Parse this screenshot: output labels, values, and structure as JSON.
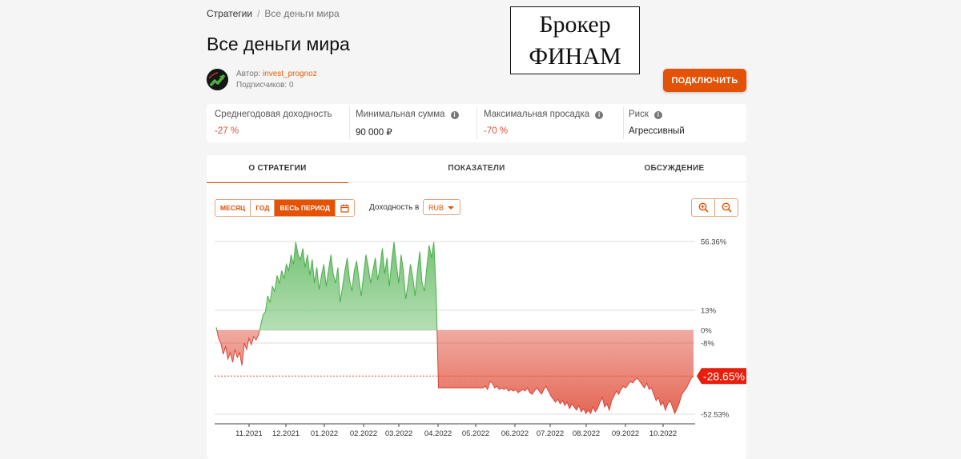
{
  "breadcrumb": {
    "parent": "Стратегии",
    "separator": "/",
    "current": "Все деньги мира"
  },
  "page_title": "Все деньги мира",
  "author": {
    "label": "Автор:",
    "name": "invest_prognoz",
    "subscribers": "Подписчиков: 0"
  },
  "watermark": {
    "line1": "Брокер",
    "line2": "ФИНАМ"
  },
  "connect_button": "ПОДКЛЮЧИТЬ",
  "stats": [
    {
      "label": "Среднегодовая доходность",
      "value": "-27 %",
      "info": false,
      "negative": true
    },
    {
      "label": "Минимальная сумма",
      "value": "90 000 ₽",
      "info": true,
      "negative": false
    },
    {
      "label": "Максимальная просадка",
      "value": "-70 %",
      "info": true,
      "negative": true
    },
    {
      "label": "Риск",
      "value": "Агрессивный",
      "info": true,
      "negative": false
    }
  ],
  "tabs": [
    {
      "label": "О СТРАТЕГИИ",
      "active": true
    },
    {
      "label": "ПОКАЗАТЕЛИ",
      "active": false
    },
    {
      "label": "ОБСУЖДЕНИЕ",
      "active": false
    }
  ],
  "period_buttons": [
    {
      "label": "МЕСЯЦ",
      "active": false
    },
    {
      "label": "ГОД",
      "active": false
    },
    {
      "label": "ВЕСЬ ПЕРИОД",
      "active": true
    }
  ],
  "yield_label": "Доходность в",
  "currency": "RUB",
  "icons": {
    "calendar": "calendar-icon",
    "zoom_in": "zoom-in-icon",
    "zoom_out": "zoom-out-icon",
    "info": "info-icon"
  },
  "colors": {
    "accent": "#e35205",
    "positive": "#5cb85c",
    "negative": "#e04e39"
  },
  "chart_data": {
    "type": "area",
    "y_ticks": [
      56.36,
      13,
      0,
      -8,
      -52.53
    ],
    "y_tick_labels": [
      "56.36%",
      "13%",
      "0%",
      "-8%",
      "-52.53%"
    ],
    "current_value_label": "-28.65%",
    "current_value": -28.65,
    "x_ticks": [
      "11.2021",
      "12.2021",
      "01.2022",
      "02.2022",
      "03.2022",
      "04.2022",
      "05.2022",
      "06.2022",
      "07.2022",
      "08.2022",
      "09.2022",
      "10.2022"
    ],
    "series": [
      {
        "values": [
          2,
          -5,
          -8,
          -15,
          -10,
          -18,
          -14,
          -20,
          -12,
          -17,
          -14,
          -22,
          -8,
          -12,
          -5,
          -9,
          -4,
          -6,
          -3,
          3,
          10,
          12,
          22,
          18,
          28,
          25,
          35,
          30,
          38,
          33,
          42,
          38,
          48,
          42,
          56,
          48,
          45,
          52,
          40,
          48,
          35,
          45,
          30,
          40,
          26,
          35,
          42,
          28,
          38,
          48,
          36,
          30,
          40,
          18,
          28,
          38,
          46,
          32,
          25,
          38,
          44,
          33,
          22,
          36,
          48,
          40,
          30,
          38,
          46,
          32,
          40,
          52,
          36,
          46,
          28,
          44,
          56,
          42,
          30,
          48,
          38,
          20,
          30,
          42,
          34,
          22,
          38,
          50,
          30,
          25,
          40,
          54,
          46,
          56,
          25,
          -36,
          -36,
          -36,
          -36,
          -36,
          -36,
          -36,
          -36,
          -36,
          -36,
          -36,
          -36,
          -36,
          -36,
          -36,
          -36,
          -36,
          -36,
          -36,
          -36,
          -35,
          -37,
          -32,
          -33,
          -36,
          -35,
          -37,
          -36,
          -37,
          -36,
          -38,
          -37,
          -38,
          -37,
          -39,
          -38,
          -37,
          -38,
          -36,
          -39,
          -40,
          -38,
          -36,
          -38,
          -40,
          -37,
          -35,
          -38,
          -41,
          -43,
          -45,
          -43,
          -46,
          -44,
          -47,
          -45,
          -49,
          -46,
          -48,
          -50,
          -47,
          -51,
          -49,
          -52,
          -50,
          -52,
          -48,
          -51,
          -49,
          -45,
          -42,
          -48,
          -46,
          -50,
          -44,
          -41,
          -38,
          -40,
          -37,
          -35,
          -36,
          -34,
          -32,
          -33,
          -31,
          -30,
          -32,
          -34,
          -36,
          -33,
          -37,
          -36,
          -40,
          -44,
          -42,
          -47,
          -45,
          -50,
          -46,
          -44,
          -48,
          -52,
          -49,
          -45,
          -40,
          -38,
          -36,
          -33,
          -30,
          -28.65
        ]
      }
    ]
  }
}
